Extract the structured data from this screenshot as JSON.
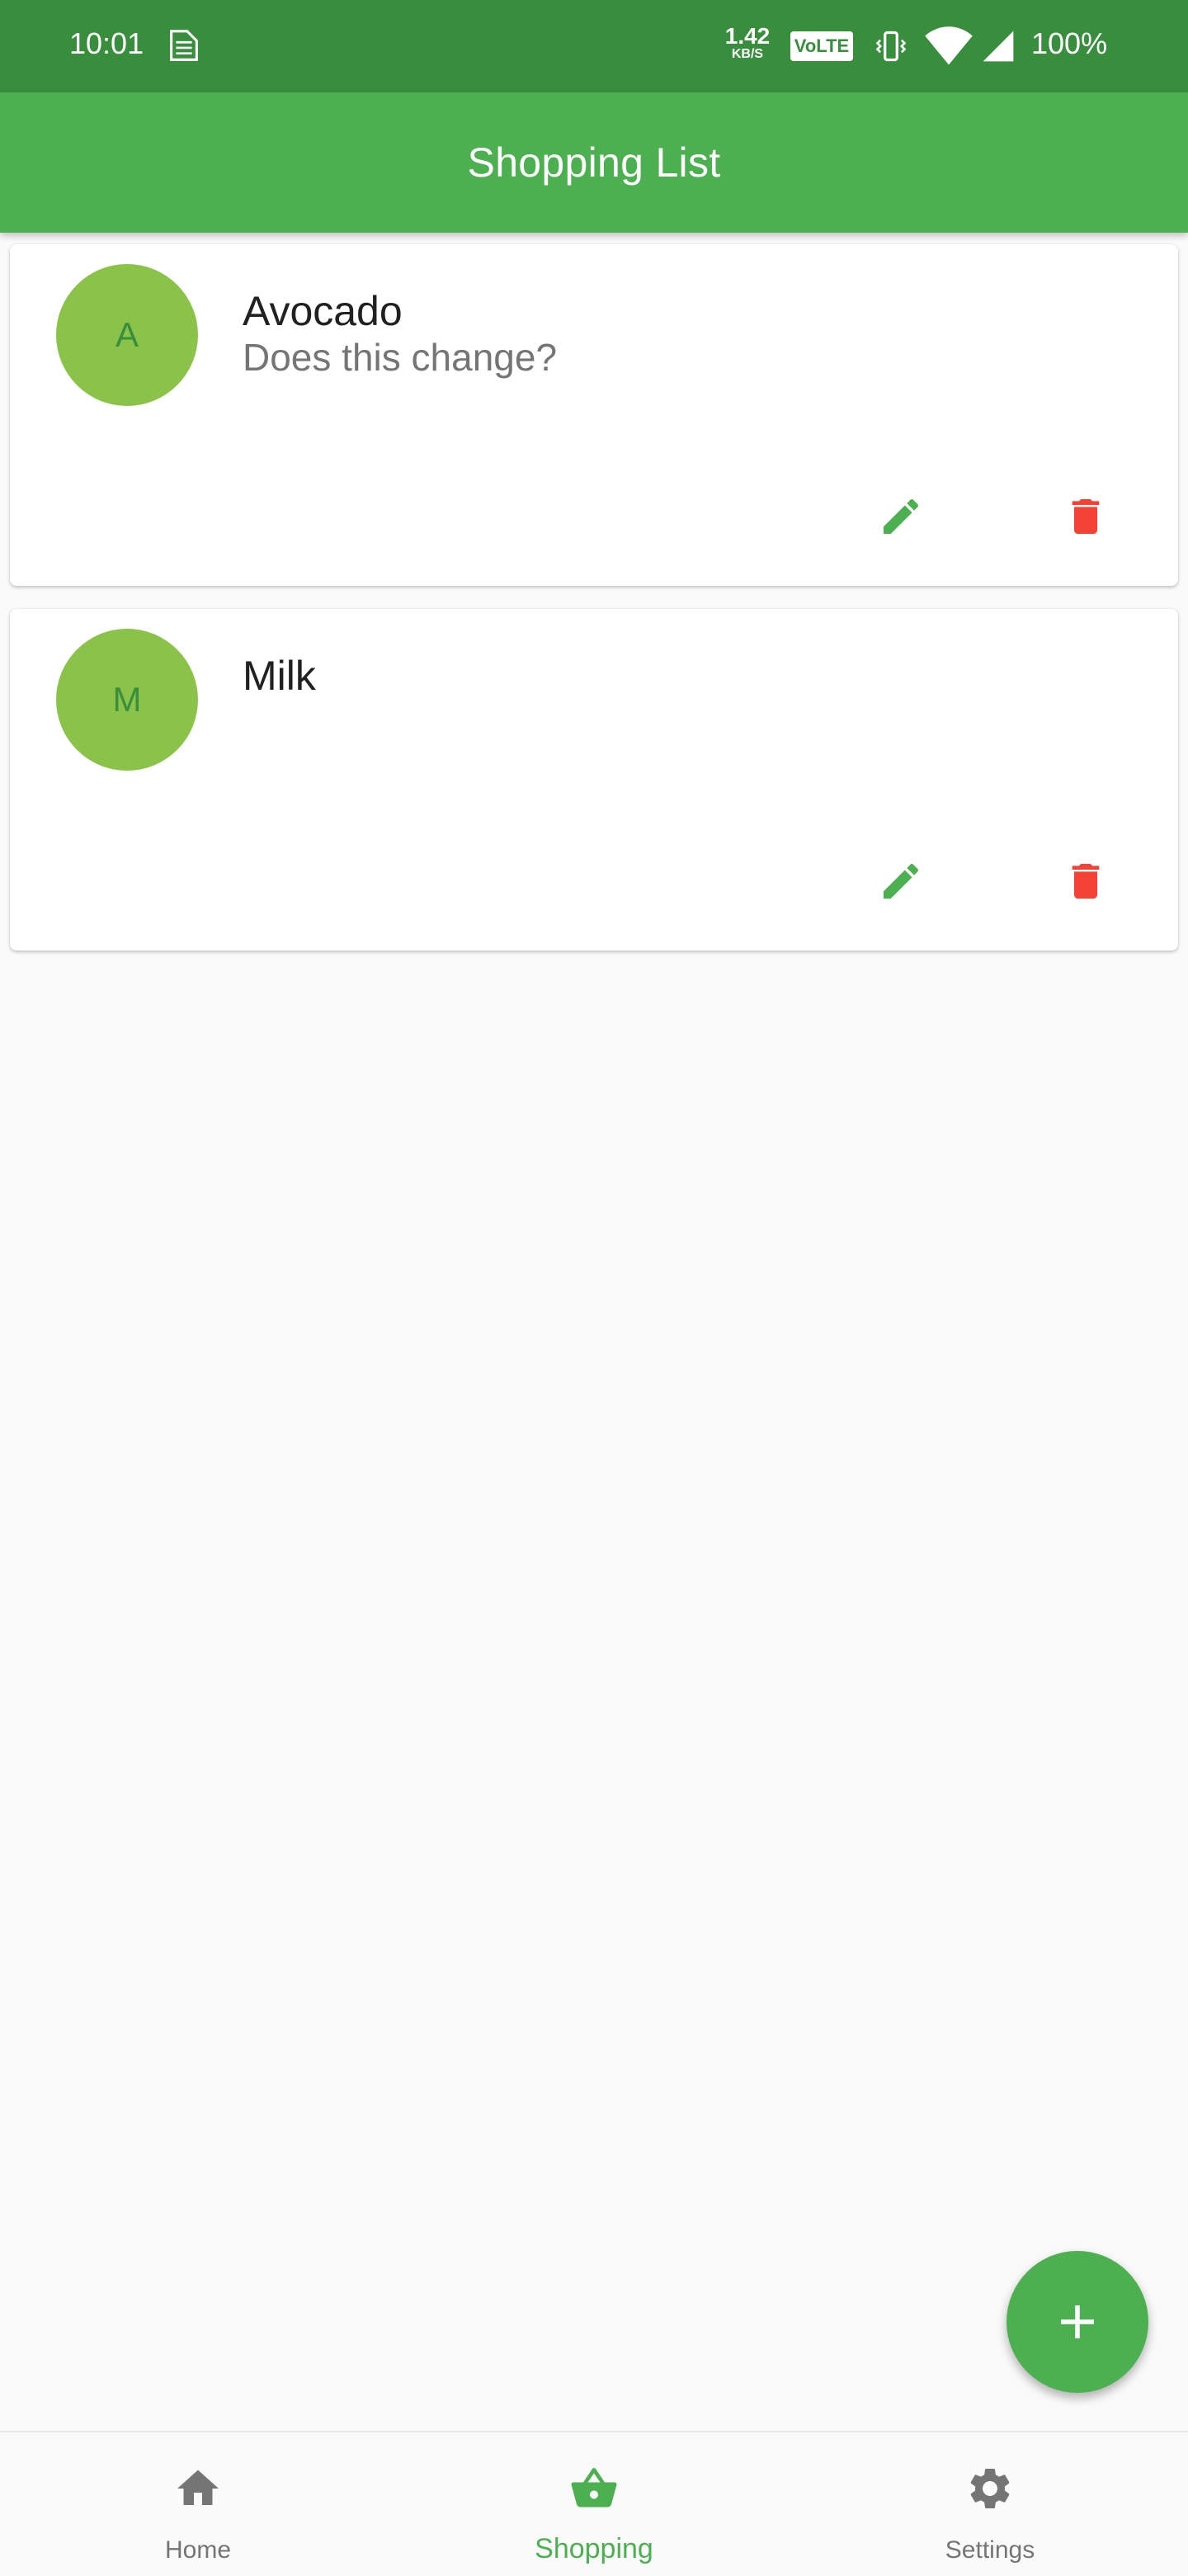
{
  "status_bar": {
    "time": "10:01",
    "net_speed_value": "1.42",
    "net_speed_unit": "KB/S",
    "volte": "VoLTE",
    "battery": "100%"
  },
  "app_bar": {
    "title": "Shopping List"
  },
  "items": [
    {
      "initial": "A",
      "name": "Avocado",
      "description": "Does this change?"
    },
    {
      "initial": "M",
      "name": "Milk",
      "description": ""
    }
  ],
  "bottom_nav": {
    "items": [
      {
        "label": "Home",
        "icon": "home-icon"
      },
      {
        "label": "Shopping",
        "icon": "basket-icon",
        "active": true
      },
      {
        "label": "Settings",
        "icon": "gear-icon"
      }
    ]
  },
  "colors": {
    "status_bar": "#388e3c",
    "primary": "#4caf50",
    "avatar": "#8bc34a",
    "delete": "#f44336"
  }
}
